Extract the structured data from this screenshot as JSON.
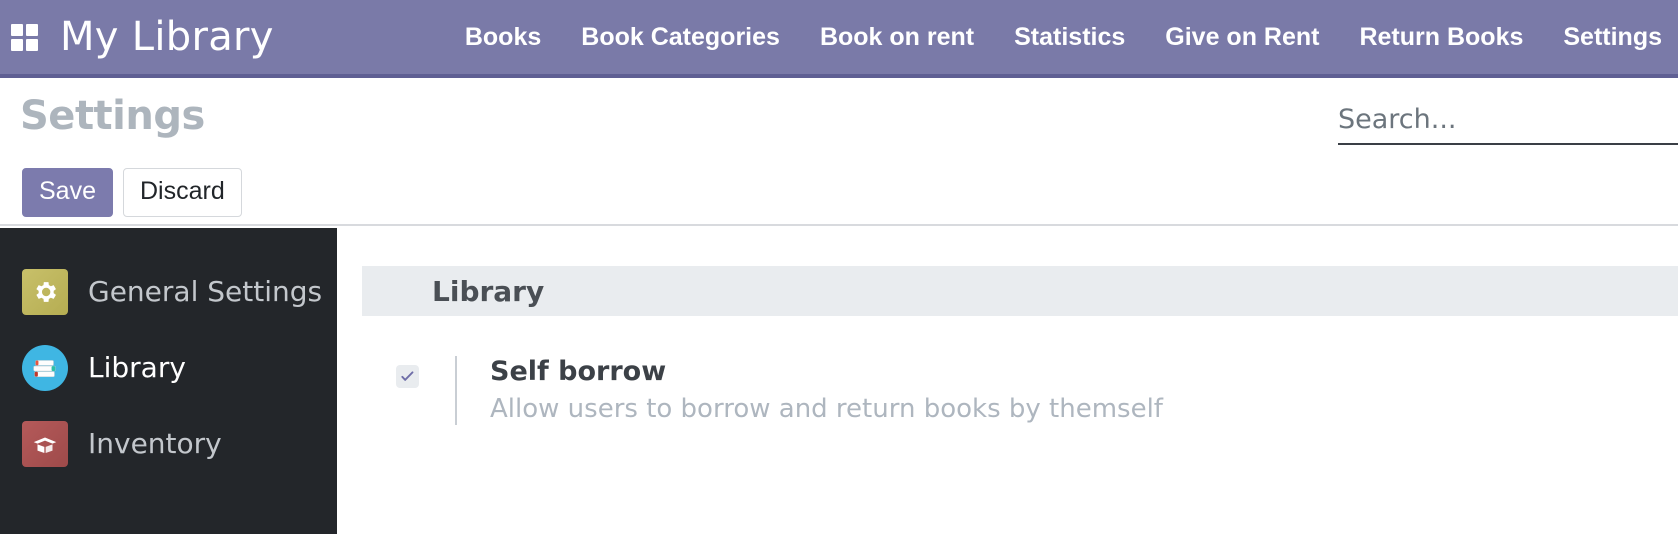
{
  "navbar": {
    "apps_icon": "apps-grid-icon",
    "brand": "My Library",
    "links": [
      {
        "label": "Books"
      },
      {
        "label": "Book Categories"
      },
      {
        "label": "Book on rent"
      },
      {
        "label": "Statistics"
      },
      {
        "label": "Give on Rent"
      },
      {
        "label": "Return Books"
      },
      {
        "label": "Settings"
      }
    ],
    "background_color": "#7a7aa8",
    "border_color": "#5f5f93"
  },
  "control_panel": {
    "page_title": "Settings",
    "save_label": "Save",
    "discard_label": "Discard",
    "save_color": "#7c7bad"
  },
  "search": {
    "placeholder": "Search...",
    "value": ""
  },
  "sidebar": {
    "background_color": "#23262a",
    "items": [
      {
        "label": "General Settings",
        "icon": "gear-icon",
        "icon_color": "#b5ad52",
        "active": false
      },
      {
        "label": "Library",
        "icon": "books-stack-icon",
        "icon_color": "#3fb6e3",
        "active": true
      },
      {
        "label": "Inventory",
        "icon": "open-box-icon",
        "icon_color": "#9e4a4a",
        "active": false
      }
    ]
  },
  "settings_panel": {
    "section_title": "Library",
    "section_band_color": "#e9ecef",
    "options": [
      {
        "title": "Self borrow",
        "description": "Allow users to borrow and return books by themself",
        "checked": true,
        "check_color": "#7c7bad"
      }
    ]
  }
}
